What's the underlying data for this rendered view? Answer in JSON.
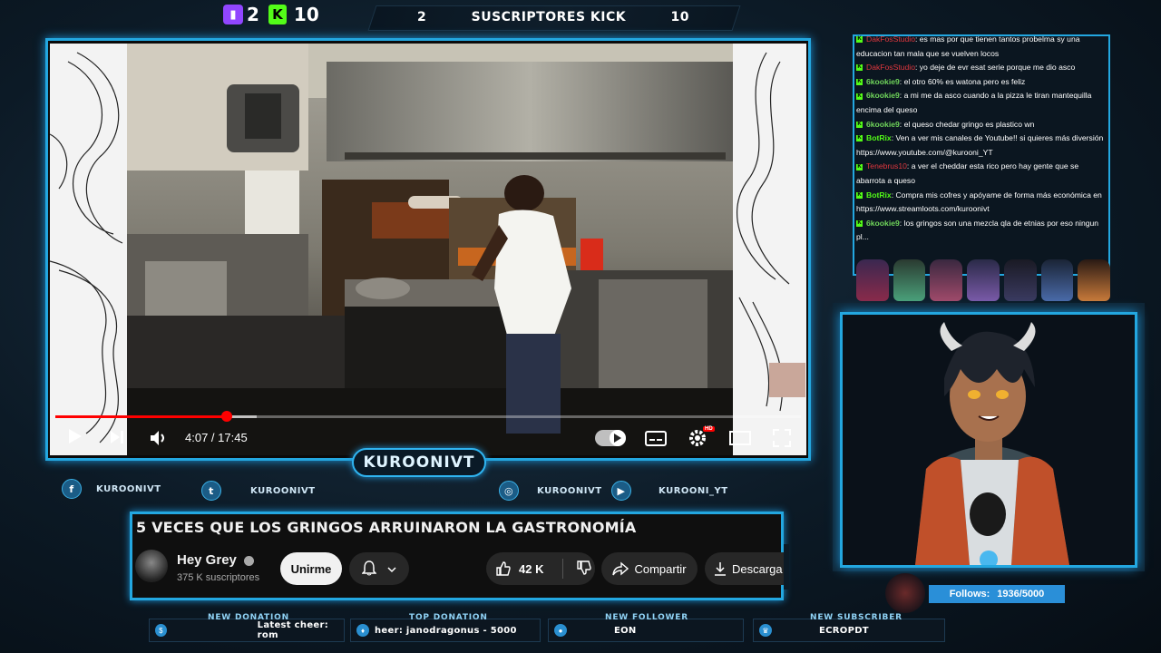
{
  "top_bar": {
    "twitch_count": "2",
    "kick_count": "10",
    "subs_left": "2",
    "subs_title": "SUSCRIPTORES KICK",
    "subs_right": "10"
  },
  "video": {
    "time": "4:07 / 17:45",
    "progress": 0.23,
    "buffered": 0.27,
    "quality_badge": "HD"
  },
  "streamer_name": "KUROONIVT",
  "socials": [
    {
      "icon": "facebook-icon",
      "label": "KUROONIVT"
    },
    {
      "icon": "twitter-icon",
      "label": "KUROONIVT"
    },
    {
      "icon": "instagram-icon",
      "label": "KUROONIVT"
    },
    {
      "icon": "youtube-icon",
      "label": "KUROONI_YT"
    }
  ],
  "yt_info": {
    "title": "5 VECES QUE LOS GRINGOS ARRUINARON LA GASTRONOMÍA",
    "channel": "Hey Grey",
    "subscribers": "375 K suscriptores",
    "join_label": "Unirme",
    "likes": "42 K",
    "share_label": "Compartir",
    "download_label": "Descarga"
  },
  "chat": [
    {
      "user": "DakFosStudio",
      "style": "red",
      "text": ": es mas por que tienen tantos probelma sy una educacion tan mala que se vuelven locos"
    },
    {
      "user": "DakFosStudio",
      "style": "red",
      "text": ": yo deje de evr esat serie porque me dio asco"
    },
    {
      "user": "6kookie9",
      "style": "green",
      "text": ": el otro 60% es watona pero es feliz"
    },
    {
      "user": "6kookie9",
      "style": "green",
      "text": ": a mi me da asco cuando a la pizza le tiran mantequilla encima del queso"
    },
    {
      "user": "6kookie9",
      "style": "green",
      "text": ": el queso chedar gringo es plastico wn"
    },
    {
      "user": "BotRix",
      "style": "bot",
      "text": ": Ven a ver mis canales de Youtube!! si quieres más diversión https://www.youtube.com/@kurooni_YT"
    },
    {
      "user": "Tenebrus10",
      "style": "red",
      "text": ": a ver el cheddar esta rico pero hay gente que se abarrota a queso"
    },
    {
      "user": "BotRix",
      "style": "bot",
      "text": ": Compra mis cofres y apóyame de forma más económica en https://www.streamloots.com/kuroonivt"
    },
    {
      "user": "6kookie9",
      "style": "green",
      "text": ": los gringos son una mezcla qla de etnias por eso ningun pl..."
    }
  ],
  "follows": {
    "label": "Follows:",
    "value": "1936/5000"
  },
  "alerts": [
    {
      "label": "NEW DONATION",
      "text": "Latest cheer: rom"
    },
    {
      "label": "TOP DONATION",
      "text": "heer: janodragonus - 5000"
    },
    {
      "label": "NEW FOLLOWER",
      "text": "EON"
    },
    {
      "label": "NEW SUBSCRIBER",
      "text": "ECROPDT"
    }
  ],
  "colors": {
    "accent": "#23a7e0",
    "twitch": "#9146ff",
    "kick": "#53fc18",
    "yt_red": "#ff0000"
  }
}
